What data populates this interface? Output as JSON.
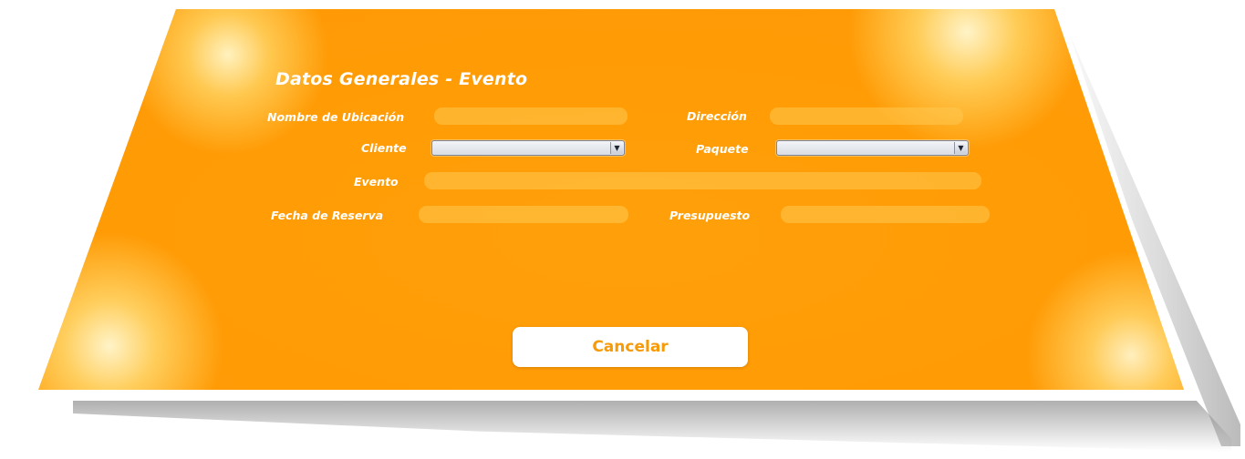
{
  "form": {
    "title": "Datos Generales - Evento",
    "labels": {
      "nombre_ubicacion": "Nombre de Ubicación",
      "direccion": "Dirección",
      "cliente": "Cliente",
      "paquete": "Paquete",
      "evento": "Evento",
      "fecha_reserva": "Fecha de Reserva",
      "presupuesto": "Presupuesto"
    },
    "values": {
      "nombre_ubicacion": "",
      "direccion": "",
      "cliente": "",
      "paquete": "",
      "evento": "",
      "fecha_reserva": "",
      "presupuesto": ""
    }
  },
  "buttons": {
    "cancel_label": "Cancelar"
  },
  "icons": {
    "dropdown": "chevron-down-icon"
  },
  "colors": {
    "background": "#ff9b05",
    "field": "#ffc850",
    "button_text": "#f79a07",
    "text": "#ffffff"
  }
}
